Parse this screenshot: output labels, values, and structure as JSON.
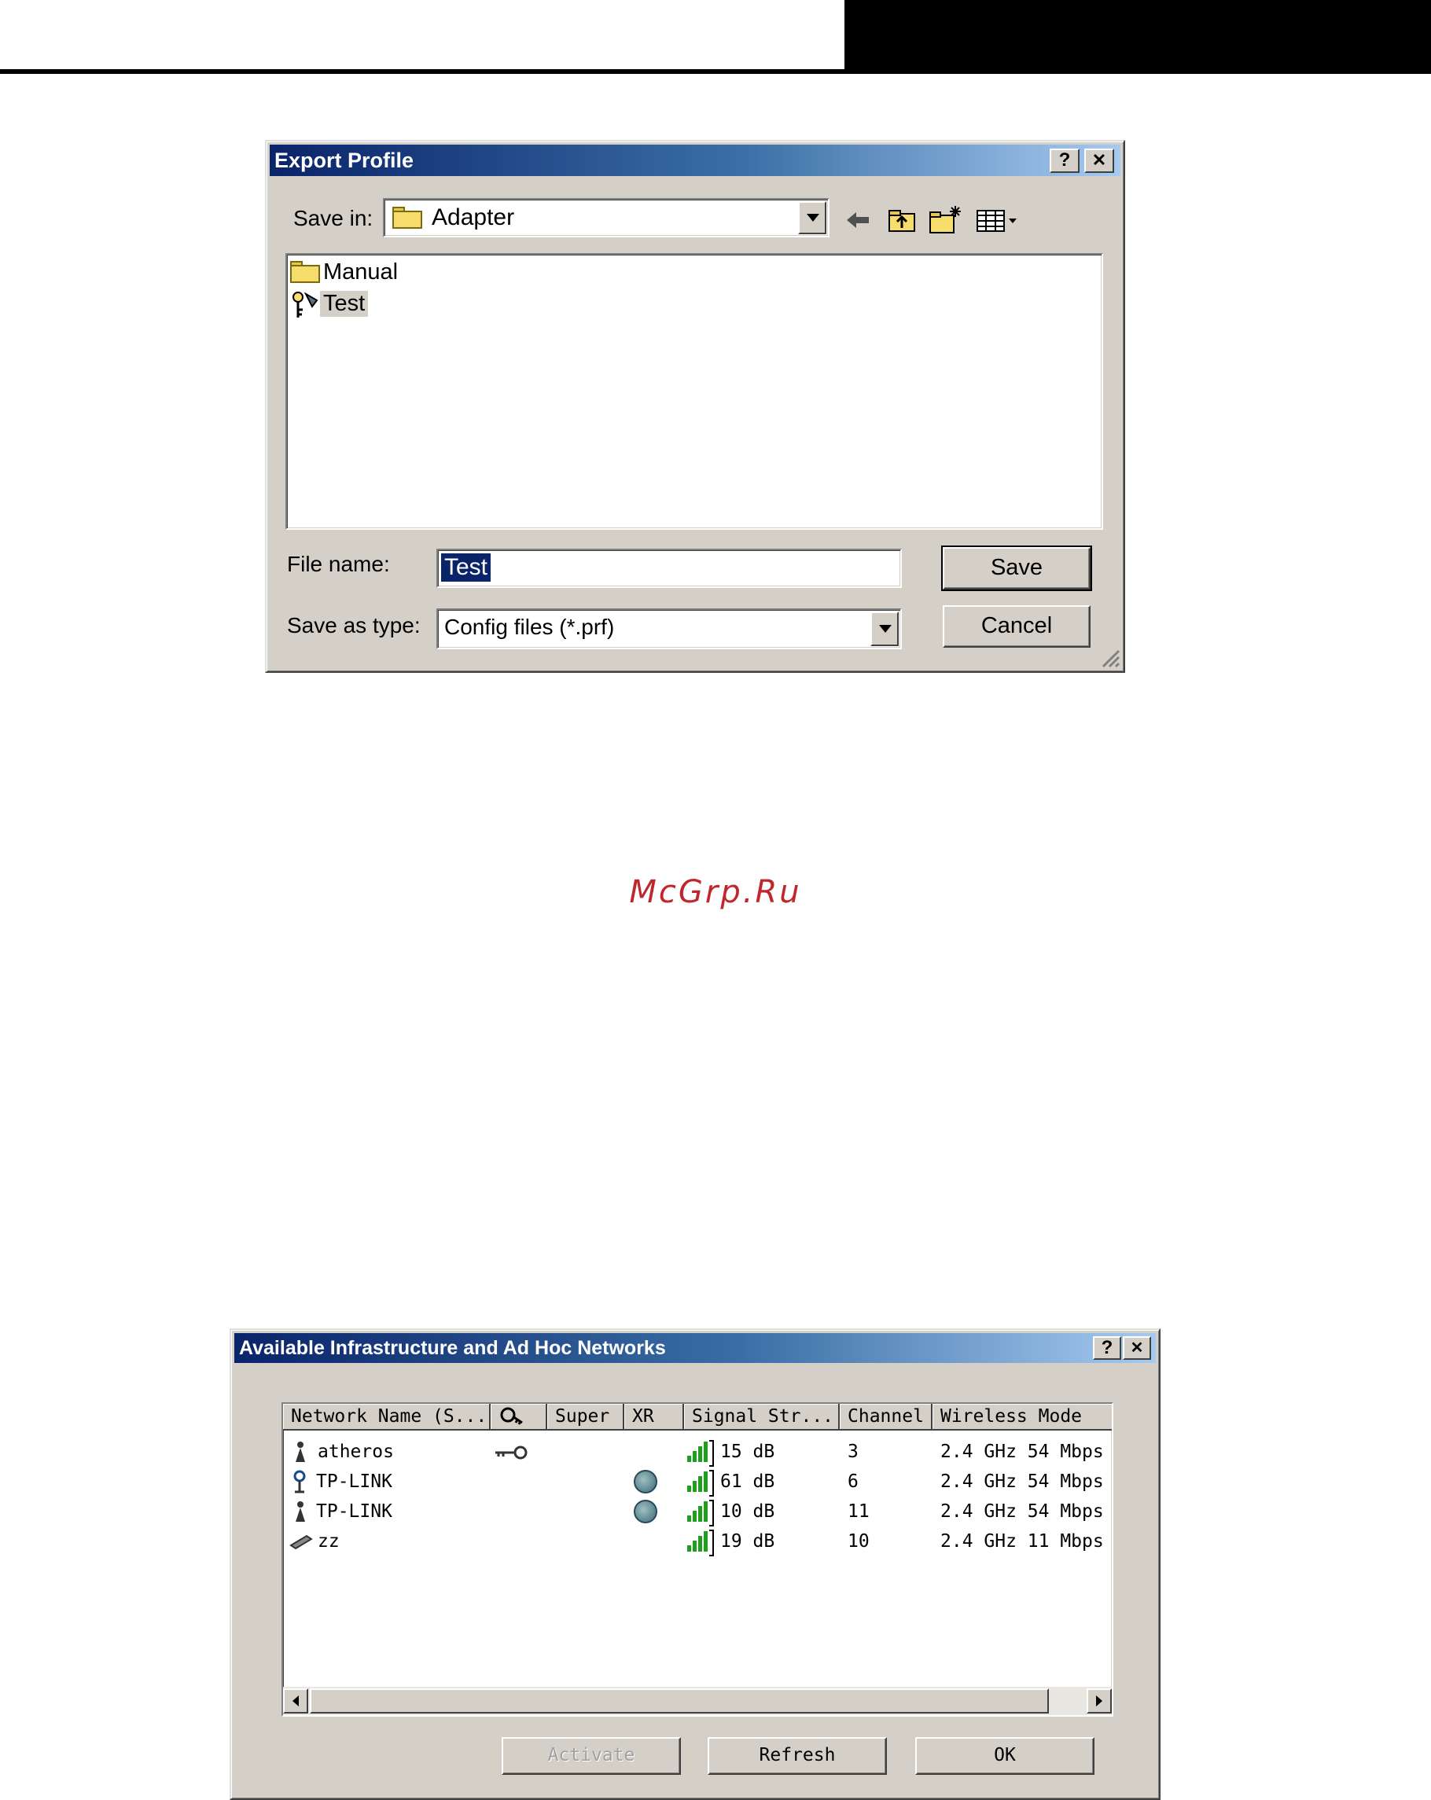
{
  "export_dialog": {
    "title": "Export Profile",
    "help_label": "?",
    "close_label": "✕",
    "save_in_label": "Save in:",
    "save_in_value": "Adapter",
    "files": [
      {
        "name": "Manual",
        "icon": "folder-icon"
      },
      {
        "name": "Test",
        "icon": "profile-file-icon"
      }
    ],
    "file_name_label": "File name:",
    "file_name_value": "Test",
    "save_as_type_label": "Save as type:",
    "save_as_type_value": "Config files (*.prf)",
    "save_button": "Save",
    "cancel_button": "Cancel"
  },
  "watermark": "McGrp.Ru",
  "networks_dialog": {
    "title": "Available Infrastructure and Ad Hoc Networks",
    "help_label": "?",
    "close_label": "✕",
    "columns": [
      "Network Name (S...",
      "",
      "Super",
      "XR",
      "Signal Str...",
      "Channel",
      "Wireless Mode"
    ],
    "rows": [
      {
        "name": "atheros",
        "type_icon": "access-point-icon",
        "secured": true,
        "xr": false,
        "signal": "15 dB",
        "signal_bars": 4,
        "channel": "3",
        "mode": "2.4 GHz 54 Mbps"
      },
      {
        "name": "TP-LINK",
        "type_icon": "connected-ap-icon",
        "secured": false,
        "xr": true,
        "signal": "61 dB",
        "signal_bars": 4,
        "channel": "6",
        "mode": "2.4 GHz 54 Mbps"
      },
      {
        "name": "TP-LINK",
        "type_icon": "access-point-icon",
        "secured": false,
        "xr": true,
        "signal": "10 dB",
        "signal_bars": 4,
        "channel": "11",
        "mode": "2.4 GHz 54 Mbps"
      },
      {
        "name": "zz",
        "type_icon": "adhoc-icon",
        "secured": false,
        "xr": false,
        "signal": "19 dB",
        "signal_bars": 4,
        "channel": "10",
        "mode": "2.4 GHz 11 Mbps"
      }
    ],
    "activate_button": "Activate",
    "refresh_button": "Refresh",
    "ok_button": "OK"
  },
  "colors": {
    "title_start": "#0a246a",
    "title_end": "#a6caf0",
    "watermark": "#c0272d",
    "signal_green": "#1ea01e"
  }
}
